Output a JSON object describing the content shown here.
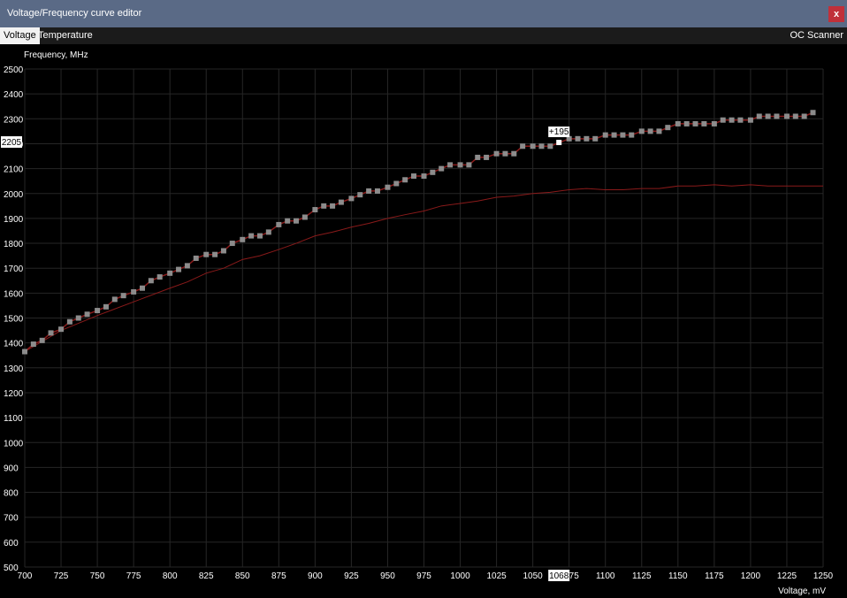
{
  "window": {
    "title": "Voltage/Frequency curve editor",
    "close_label": "x"
  },
  "tabs": [
    {
      "label": "Voltage",
      "active": true
    },
    {
      "label": "Temperature",
      "active": false
    }
  ],
  "oc_scanner_label": "OC Scanner",
  "colors": {
    "titlebar": "#5a6a86",
    "close": "#c0303a",
    "curve": "#8a1a1a",
    "point": "#8c8c8c",
    "grid": "#262626"
  },
  "chart_data": {
    "type": "line",
    "ylabel": "Frequency, MHz",
    "xlabel": "Voltage, mV",
    "xlim": [
      700,
      1250
    ],
    "ylim": [
      500,
      2500
    ],
    "x_ticks": [
      "700",
      "725",
      "750",
      "775",
      "800",
      "825",
      "850",
      "875",
      "900",
      "925",
      "950",
      "975",
      "1000",
      "1025",
      "1050",
      "1075",
      "1100",
      "1125",
      "1150",
      "1175",
      "1200",
      "1225",
      "1250"
    ],
    "y_ticks": [
      "500",
      "600",
      "700",
      "800",
      "900",
      "1000",
      "1100",
      "1200",
      "1300",
      "1400",
      "1500",
      "1600",
      "1700",
      "1800",
      "1900",
      "2000",
      "2100",
      "2200",
      "2300",
      "2400",
      "2500"
    ],
    "grid": true,
    "highlight": {
      "x_label": "1068",
      "y_label": "2205",
      "offset_label": "+195",
      "x": 1068,
      "y": 2205
    },
    "series": [
      {
        "role": "edited-curve-points",
        "x": [
          700,
          706,
          712,
          718,
          725,
          731,
          737,
          743,
          750,
          756,
          762,
          768,
          775,
          781,
          787,
          793,
          800,
          806,
          812,
          818,
          825,
          831,
          837,
          843,
          850,
          856,
          862,
          868,
          875,
          881,
          887,
          893,
          900,
          906,
          912,
          918,
          925,
          931,
          937,
          943,
          950,
          956,
          962,
          968,
          975,
          981,
          987,
          993,
          1000,
          1006,
          1012,
          1018,
          1025,
          1031,
          1037,
          1043,
          1050,
          1056,
          1062,
          1075,
          1081,
          1087,
          1093,
          1100,
          1106,
          1112,
          1118,
          1125,
          1131,
          1137,
          1143,
          1150,
          1156,
          1162,
          1168,
          1175,
          1181,
          1187,
          1193,
          1200,
          1206,
          1212,
          1218,
          1225,
          1231,
          1237,
          1243
        ],
        "values": [
          1365,
          1395,
          1410,
          1440,
          1455,
          1485,
          1500,
          1515,
          1530,
          1545,
          1575,
          1590,
          1605,
          1620,
          1650,
          1665,
          1680,
          1695,
          1710,
          1740,
          1755,
          1755,
          1770,
          1800,
          1815,
          1830,
          1830,
          1845,
          1875,
          1890,
          1890,
          1905,
          1935,
          1950,
          1950,
          1965,
          1980,
          1995,
          2010,
          2010,
          2025,
          2040,
          2055,
          2070,
          2070,
          2085,
          2100,
          2115,
          2115,
          2115,
          2145,
          2145,
          2160,
          2160,
          2160,
          2190,
          2190,
          2190,
          2190,
          2220,
          2220,
          2220,
          2220,
          2235,
          2235,
          2235,
          2235,
          2250,
          2250,
          2250,
          2265,
          2280,
          2280,
          2280,
          2280,
          2280,
          2295,
          2295,
          2295,
          2295,
          2310,
          2310,
          2310,
          2310,
          2310,
          2310,
          2325
        ]
      },
      {
        "role": "reference-curve",
        "x": [
          700,
          725,
          750,
          775,
          800,
          812,
          825,
          837,
          850,
          862,
          875,
          887,
          900,
          912,
          925,
          937,
          950,
          962,
          975,
          987,
          1000,
          1012,
          1025,
          1037,
          1050,
          1062,
          1075,
          1087,
          1100,
          1112,
          1125,
          1137,
          1150,
          1162,
          1175,
          1187,
          1200,
          1212,
          1225,
          1237,
          1250
        ],
        "values": [
          1365,
          1450,
          1510,
          1565,
          1620,
          1645,
          1680,
          1700,
          1735,
          1750,
          1775,
          1800,
          1830,
          1845,
          1865,
          1880,
          1900,
          1915,
          1930,
          1950,
          1960,
          1970,
          1985,
          1990,
          2000,
          2005,
          2015,
          2020,
          2015,
          2015,
          2020,
          2020,
          2030,
          2030,
          2035,
          2030,
          2035,
          2030,
          2030,
          2030,
          2030
        ]
      }
    ]
  }
}
